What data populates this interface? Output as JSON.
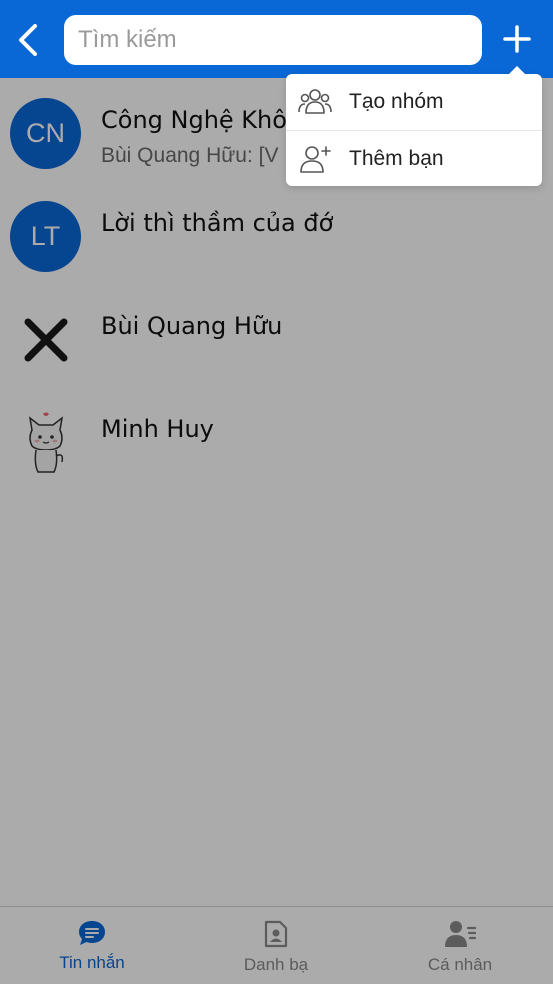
{
  "header": {
    "search_placeholder": "Tìm kiếm"
  },
  "conversations": [
    {
      "initials": "CN",
      "name": "Công Nghệ Khô",
      "preview": "Bùi Quang Hữu: [V",
      "avatar_color": "#0a68d6"
    },
    {
      "initials": "LT",
      "name": "Lời thì thầm của đớ",
      "preview": "",
      "avatar_color": "#0a68d6"
    },
    {
      "initials": "",
      "name": "Bùi Quang Hữu",
      "preview": "",
      "avatar_icon": "x-mark-icon"
    },
    {
      "initials": "",
      "name": "Minh Huy",
      "preview": "",
      "avatar_icon": "cat-sticker-icon"
    }
  ],
  "menu": {
    "items": [
      {
        "label": "Tạo nhóm",
        "icon": "group-icon"
      },
      {
        "label": "Thêm bạn",
        "icon": "add-friend-icon"
      }
    ]
  },
  "tabs": [
    {
      "label": "Tin nhắn",
      "icon": "chat-bubble-icon",
      "active": true
    },
    {
      "label": "Danh bạ",
      "icon": "contact-book-icon",
      "active": false
    },
    {
      "label": "Cá nhân",
      "icon": "profile-icon",
      "active": false
    }
  ],
  "colors": {
    "primary": "#0a68d6",
    "inactive": "#8a8a8a"
  }
}
